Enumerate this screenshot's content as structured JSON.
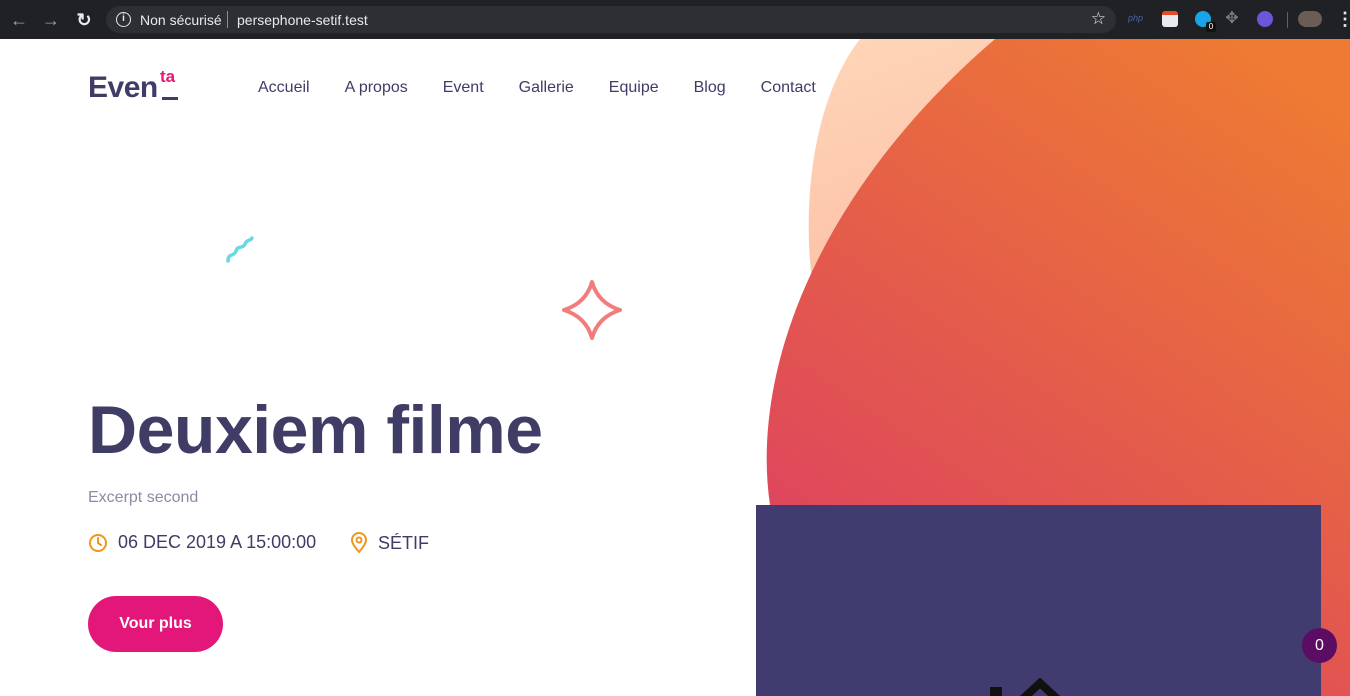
{
  "browser": {
    "security_label": "Non sécurisé",
    "url": "persephone-setif.test",
    "info_icon": "i",
    "back_icon": "←",
    "forward_icon": "→",
    "reload_icon": "↻",
    "star_icon": "☆",
    "menu_icon": "⋮",
    "extensions": {
      "php_label": "php",
      "badge_count": "0",
      "move_icon": "✥"
    }
  },
  "site": {
    "logo": {
      "text": "Even",
      "superscript": "ta"
    },
    "nav": [
      {
        "label": "Accueil"
      },
      {
        "label": "A propos"
      },
      {
        "label": "Event"
      },
      {
        "label": "Gallerie"
      },
      {
        "label": "Equipe"
      },
      {
        "label": "Blog"
      },
      {
        "label": "Contact"
      }
    ]
  },
  "hero": {
    "title": "Deuxiem filme",
    "excerpt": "Excerpt second",
    "date": "06 DEC 2019 A 15:00:00",
    "location": "SÉTIF",
    "cta_label": "Vour plus"
  },
  "cart": {
    "count": "0"
  },
  "colors": {
    "brand_dark": "#3f3c66",
    "accent_pink": "#e3177a",
    "accent_orange": "#f0961c",
    "video_bg": "#403c70",
    "cart_bg": "#5a0d62"
  }
}
